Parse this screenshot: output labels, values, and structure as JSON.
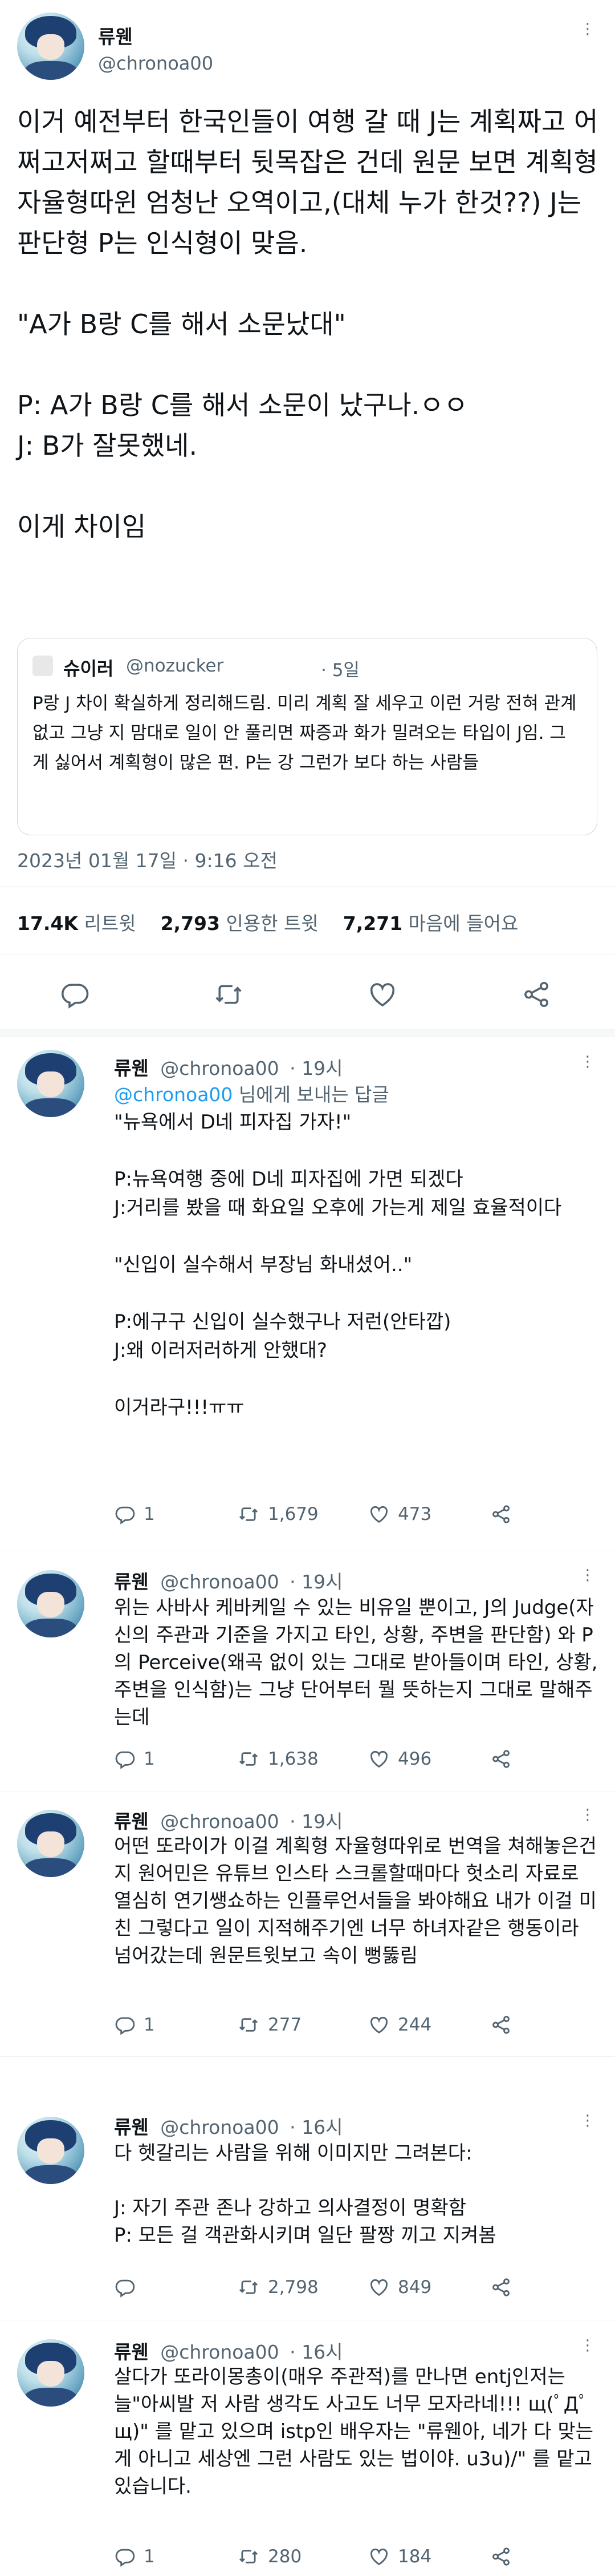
{
  "main_tweet": {
    "display_name": "류웬",
    "handle": "@chronoa00",
    "body": "이거 예전부터 한국인들이 여행 갈 때 J는 계획짜고 어쩌고저쩌고 할때부터 뒷목잡은 건데 원문 보면 계획형 자율형따윈 엄청난 오역이고,(대체 누가 한것??) J는 판단형 P는 인식형이 맞음.\n\n\"A가 B랑 C를 해서 소문났대\"\n\nP: A가 B랑 C를 해서 소문이 났구나.ㅇㅇ\nJ: B가 잘못했네.\n\n이게 차이임",
    "quote": {
      "display_name": "슈이러",
      "handle": "@nozucker",
      "time": "· 5일",
      "body": "P랑 J 차이 확실하게 정리해드림. 미리 계획 잘 세우고 이런 거랑 전혀 관계 없고 그냥 지 맘대로 일이 안 풀리면 짜증과 화가 밀려오는 타입이 J임. 그게 싫어서 계획형이 많은 편. P는 강 그런가 보다 하는 사람들"
    },
    "timestamp": "2023년 01월 17일 · 9:16 오전",
    "stats": {
      "retweets": "17.4K",
      "retweets_label": "리트윗",
      "quotes": "2,793",
      "quotes_label": "인용한 트윗",
      "likes": "7,271",
      "likes_label": "마음에 들어요"
    }
  },
  "replies": [
    {
      "display_name": "류웬",
      "handle": "@chronoa00",
      "time": "· 19시",
      "reply_to": "@chronoa00",
      "reply_suffix": " 님에게 보내는 답글",
      "body": "\"뉴욕에서 D네 피자집 가자!\"\n\nP:뉴욕여행 중에 D네 피자집에 가면 되겠다\nJ:거리를 봤을 때 화요일 오후에 가는게 제일 효율적이다\n\n\"신입이 실수해서 부장님 화내셨어..\"\n\nP:에구구 신입이 실수했구나 저런(안타깝)\nJ:왜 이러저러하게 안했대?\n\n이거라구!!!ㅠㅠ",
      "replies_count": "1",
      "retweets_count": "1,679",
      "likes_count": "473"
    },
    {
      "display_name": "류웬",
      "handle": "@chronoa00",
      "time": "· 19시",
      "body": "위는 사바사 케바케일 수 있는 비유일 뿐이고, J의 Judge(자신의 주관과 기준을 가지고 타인, 상황, 주변을 판단함) 와 P의 Perceive(왜곡 없이 있는 그대로 받아들이며 타인, 상황, 주변을 인식함)는 그냥 단어부터 뭘 뜻하는지 그대로 말해주는데",
      "replies_count": "1",
      "retweets_count": "1,638",
      "likes_count": "496"
    },
    {
      "display_name": "류웬",
      "handle": "@chronoa00",
      "time": "· 19시",
      "body": "어떤 또라이가 이걸 계획형 자율형따위로 번역을 쳐해놓은건지 원어민은 유튜브 인스타 스크롤할때마다 헛소리 자료로 열심히 연기쌩쇼하는 인플루언서들을 봐야해요 내가 이걸 미친 그렇다고 일이 지적해주기엔 너무 하녀자같은 행동이라 넘어갔는데 원문트윗보고 속이 뻥뚫림",
      "replies_count": "1",
      "retweets_count": "277",
      "likes_count": "244"
    },
    {
      "display_name": "류웬",
      "handle": "@chronoa00",
      "time": "· 16시",
      "body": "다 헷갈리는 사람을 위해 이미지만 그려본다:\n\nJ: 자기 주관 존나 강하고 의사결정이 명확함\nP: 모든 걸 객관화시키며 일단 팔짱 끼고 지켜봄",
      "replies_count": "",
      "retweets_count": "2,798",
      "likes_count": "849"
    },
    {
      "display_name": "류웬",
      "handle": "@chronoa00",
      "time": "· 16시",
      "body": "살다가 또라이몽총이(매우 주관적)를 만나면 entj인저는 늘\"아씨발 저 사람 생각도 사고도 너무 모자라네!!! щ(ﾟДﾟщ)\" 를 맡고 있으며 istp인 배우자는 \"류웬아, 네가 다 맞는게 아니고 세상엔 그런 사람도 있는 법이야. u3u)/\" 를 맡고 있습니다.",
      "replies_count": "1",
      "retweets_count": "280",
      "likes_count": "184"
    }
  ]
}
